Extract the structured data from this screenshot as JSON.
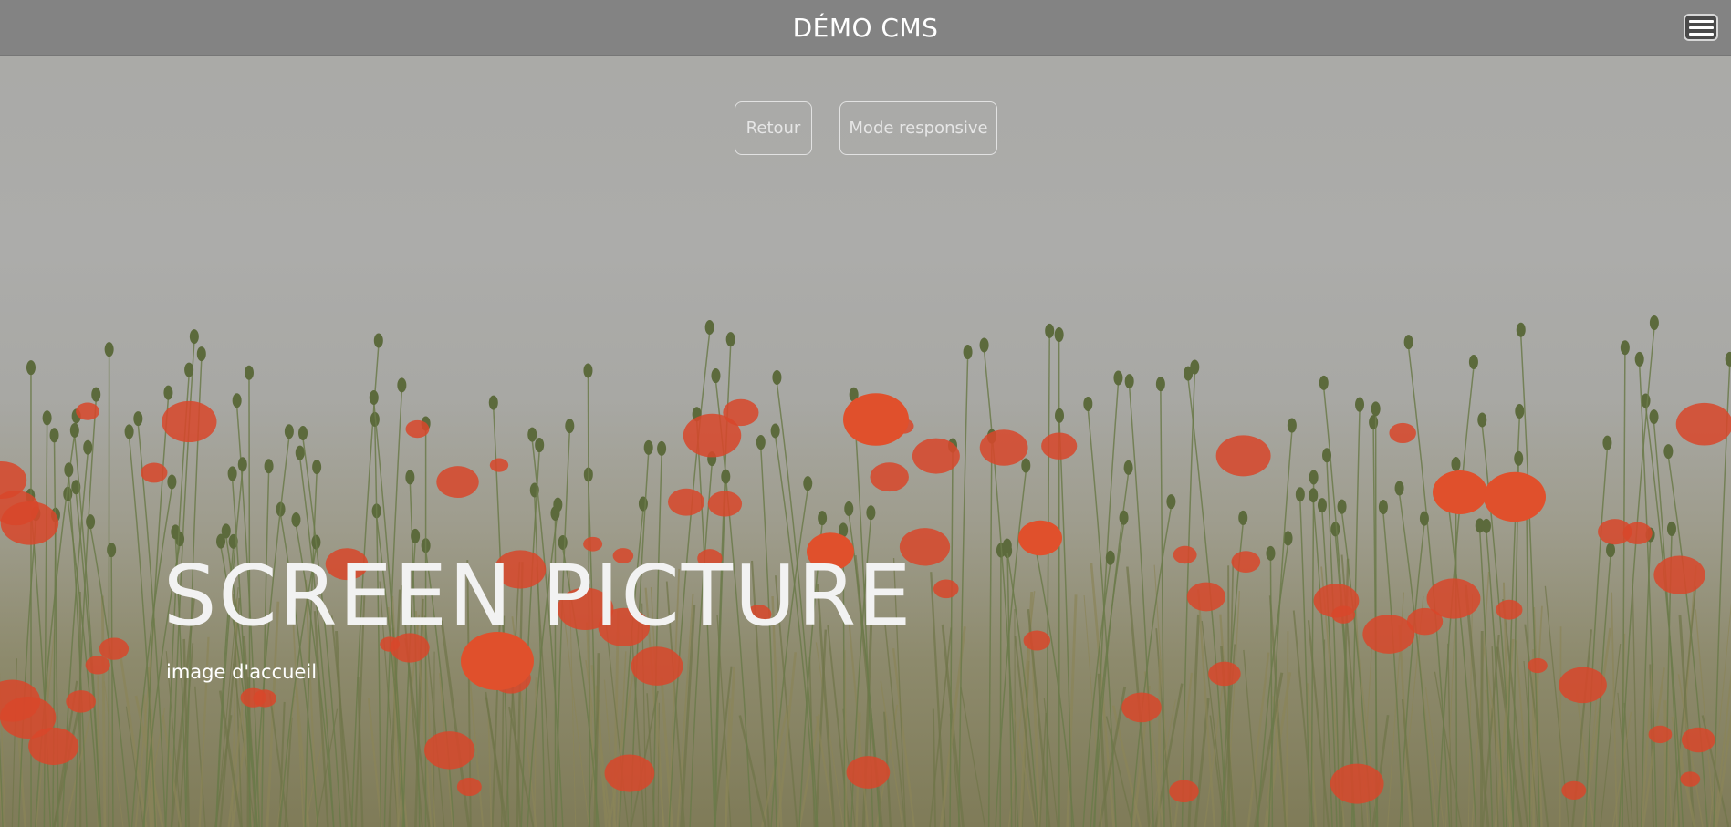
{
  "header": {
    "site_title": "DÉMO CMS",
    "menu_icon": "hamburger-menu-icon"
  },
  "toolbar": {
    "back_label": "Retour",
    "responsive_label": "Mode responsive"
  },
  "hero": {
    "title": "SCREEN PICTURE",
    "subtitle": "image d'accueil",
    "image_subject": "poppy-field-photo"
  },
  "colors": {
    "header_bg": "#808080",
    "poppy_red": "#d8472a",
    "stem_green": "#6b7a4a",
    "sky_gray": "#aaaaa7"
  }
}
